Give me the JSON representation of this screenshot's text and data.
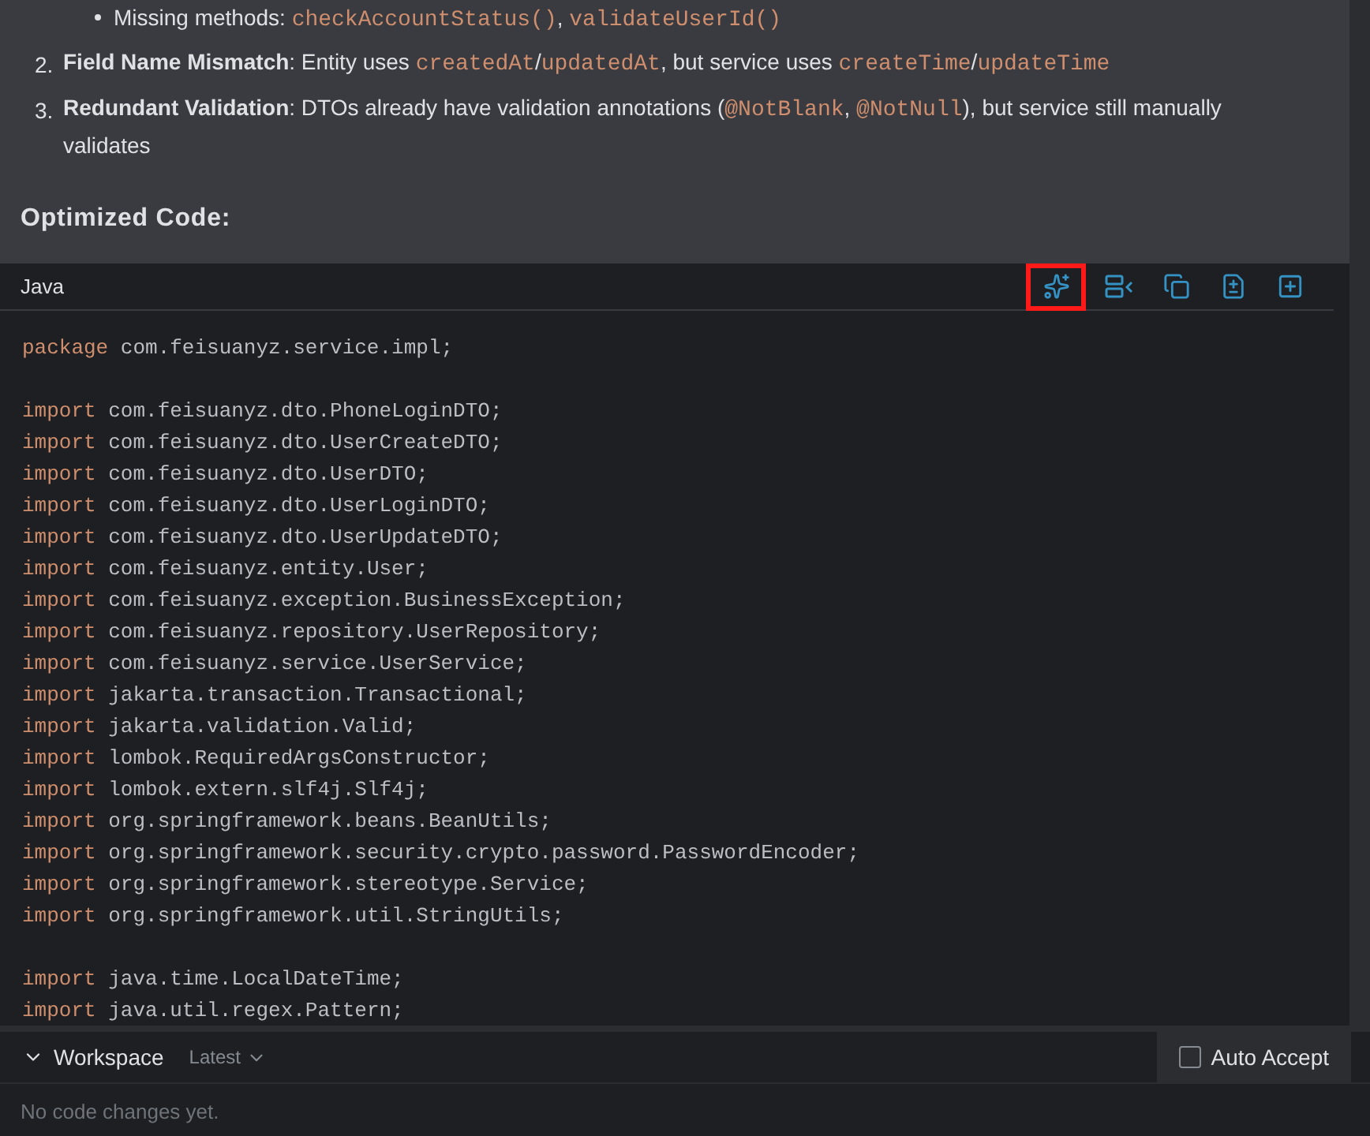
{
  "notes": {
    "bullet": {
      "label": "Missing methods: ",
      "methods": [
        "checkAccountStatus()",
        "validateUserId()"
      ],
      "separator": ", "
    },
    "items": [
      {
        "number": "2.",
        "parts": [
          {
            "kind": "bold",
            "text": "Field Name Mismatch"
          },
          {
            "kind": "text",
            "text": ": Entity uses "
          },
          {
            "kind": "code",
            "text": "createdAt"
          },
          {
            "kind": "text",
            "text": "/"
          },
          {
            "kind": "code",
            "text": "updatedAt"
          },
          {
            "kind": "text",
            "text": ", but service uses "
          },
          {
            "kind": "code",
            "text": "createTime"
          },
          {
            "kind": "text",
            "text": "/"
          },
          {
            "kind": "code",
            "text": "updateTime"
          }
        ]
      },
      {
        "number": "3.",
        "parts": [
          {
            "kind": "bold",
            "text": "Redundant Validation"
          },
          {
            "kind": "text",
            "text": ": DTOs already have validation annotations ("
          },
          {
            "kind": "code",
            "text": "@NotBlank"
          },
          {
            "kind": "text",
            "text": ", "
          },
          {
            "kind": "code",
            "text": "@NotNull"
          },
          {
            "kind": "text",
            "text": "), but service still manually validates"
          }
        ]
      }
    ]
  },
  "heading": "Optimized Code:",
  "code_block": {
    "language": "Java",
    "toolbar": [
      {
        "kind": "sparkle",
        "highlighted": true
      },
      {
        "kind": "insert",
        "highlighted": false
      },
      {
        "kind": "copy",
        "highlighted": false
      },
      {
        "kind": "diff",
        "highlighted": false
      },
      {
        "kind": "new",
        "highlighted": false
      }
    ],
    "lines": [
      {
        "kind": "code",
        "keyword": "package",
        "rest": " com.feisuanyz.service.impl;"
      },
      {
        "kind": "blank"
      },
      {
        "kind": "code",
        "keyword": "import",
        "rest": " com.feisuanyz.dto.PhoneLoginDTO;"
      },
      {
        "kind": "code",
        "keyword": "import",
        "rest": " com.feisuanyz.dto.UserCreateDTO;"
      },
      {
        "kind": "code",
        "keyword": "import",
        "rest": " com.feisuanyz.dto.UserDTO;"
      },
      {
        "kind": "code",
        "keyword": "import",
        "rest": " com.feisuanyz.dto.UserLoginDTO;"
      },
      {
        "kind": "code",
        "keyword": "import",
        "rest": " com.feisuanyz.dto.UserUpdateDTO;"
      },
      {
        "kind": "code",
        "keyword": "import",
        "rest": " com.feisuanyz.entity.User;"
      },
      {
        "kind": "code",
        "keyword": "import",
        "rest": " com.feisuanyz.exception.BusinessException;"
      },
      {
        "kind": "code",
        "keyword": "import",
        "rest": " com.feisuanyz.repository.UserRepository;"
      },
      {
        "kind": "code",
        "keyword": "import",
        "rest": " com.feisuanyz.service.UserService;"
      },
      {
        "kind": "code",
        "keyword": "import",
        "rest": " jakarta.transaction.Transactional;"
      },
      {
        "kind": "code",
        "keyword": "import",
        "rest": " jakarta.validation.Valid;"
      },
      {
        "kind": "code",
        "keyword": "import",
        "rest": " lombok.RequiredArgsConstructor;"
      },
      {
        "kind": "code",
        "keyword": "import",
        "rest": " lombok.extern.slf4j.Slf4j;"
      },
      {
        "kind": "code",
        "keyword": "import",
        "rest": " org.springframework.beans.BeanUtils;"
      },
      {
        "kind": "code",
        "keyword": "import",
        "rest": " org.springframework.security.crypto.password.PasswordEncoder;"
      },
      {
        "kind": "code",
        "keyword": "import",
        "rest": " org.springframework.stereotype.Service;"
      },
      {
        "kind": "code",
        "keyword": "import",
        "rest": " org.springframework.util.StringUtils;"
      },
      {
        "kind": "blank"
      },
      {
        "kind": "code",
        "keyword": "import",
        "rest": " java.time.LocalDateTime;"
      },
      {
        "kind": "code",
        "keyword": "import",
        "rest": " java.util.regex.Pattern;"
      }
    ]
  },
  "workspace": {
    "title": "Workspace",
    "version": "Latest",
    "auto_accept": {
      "label": "Auto Accept",
      "checked": false
    },
    "empty_message": "No code changes yet."
  }
}
